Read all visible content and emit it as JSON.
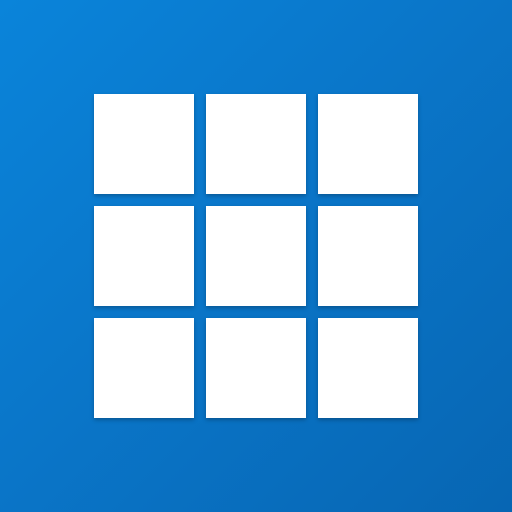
{
  "icon": {
    "name": "grid-app-icon",
    "background_colors": [
      "#0a84da",
      "#0a76c9",
      "#0766b3"
    ],
    "tile_color": "#ffffff",
    "tiles": [
      {
        "id": "tile-1"
      },
      {
        "id": "tile-2"
      },
      {
        "id": "tile-3"
      },
      {
        "id": "tile-4"
      },
      {
        "id": "tile-5"
      },
      {
        "id": "tile-6"
      },
      {
        "id": "tile-7"
      },
      {
        "id": "tile-8"
      },
      {
        "id": "tile-9"
      }
    ]
  }
}
